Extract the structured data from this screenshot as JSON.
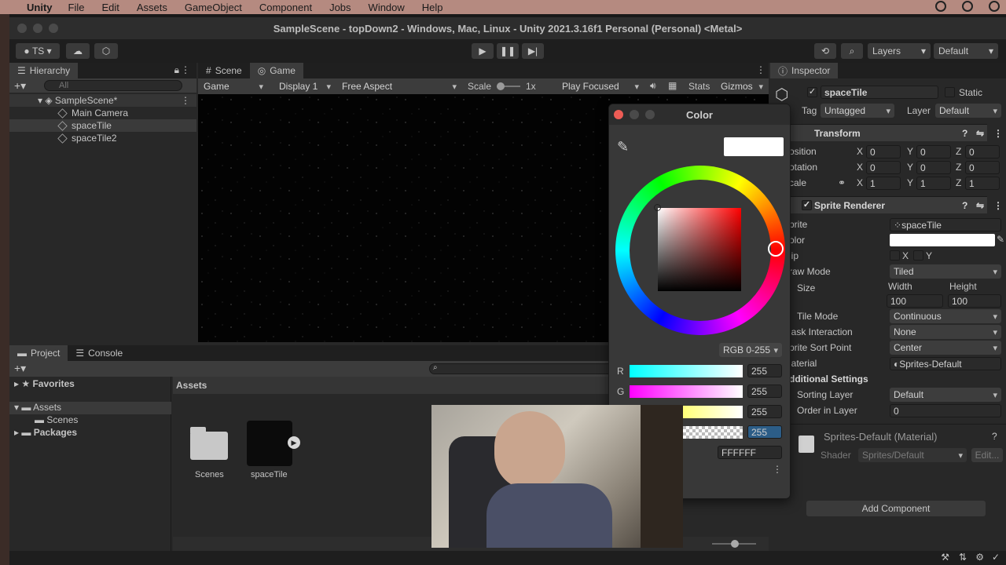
{
  "mac_menu": {
    "app": "Unity",
    "items": [
      "File",
      "Edit",
      "Assets",
      "GameObject",
      "Component",
      "Jobs",
      "Window",
      "Help"
    ]
  },
  "window_title": "SampleScene - topDown2 - Windows, Mac, Linux - Unity 2021.3.16f1 Personal (Personal) <Metal>",
  "toolbar": {
    "account": "TS",
    "layers": "Layers",
    "layout": "Default"
  },
  "hierarchy": {
    "tab": "Hierarchy",
    "search_placeholder": "All",
    "scene": "SampleScene*",
    "items": [
      "Main Camera",
      "spaceTile",
      "spaceTile2"
    ]
  },
  "scene_tabs": {
    "scene": "Scene",
    "game": "Game"
  },
  "game_bar": {
    "view": "Game",
    "display": "Display 1",
    "aspect": "Free Aspect",
    "scale_label": "Scale",
    "scale_value": "1x",
    "play_mode": "Play Focused",
    "stats": "Stats",
    "gizmos": "Gizmos"
  },
  "project": {
    "tab_project": "Project",
    "tab_console": "Console",
    "favorites": "Favorites",
    "assets": "Assets",
    "scenes": "Scenes",
    "packages": "Packages",
    "header": "Assets",
    "files": [
      "Scenes",
      "spaceTile"
    ]
  },
  "color_picker": {
    "title": "Color",
    "mode": "RGB 0-255",
    "channels": [
      {
        "label": "R",
        "value": "255"
      },
      {
        "label": "G",
        "value": "255"
      },
      {
        "label": "B",
        "value": "255"
      },
      {
        "label": "A",
        "value": "255"
      }
    ],
    "hex": "FFFFFF",
    "swatch": "#ffffff"
  },
  "inspector": {
    "tab": "Inspector",
    "object_name": "spaceTile",
    "static": "Static",
    "tag_label": "Tag",
    "tag": "Untagged",
    "layer_label": "Layer",
    "layer": "Default",
    "transform": {
      "title": "Transform",
      "position_label": "osition",
      "rotation_label": "otation",
      "scale_label": "cale",
      "position": [
        "0",
        "0",
        "0"
      ],
      "rotation": [
        "0",
        "0",
        "0"
      ],
      "scale": [
        "1",
        "1",
        "1"
      ]
    },
    "sprite_renderer": {
      "title": "Sprite Renderer",
      "sprite_label": "prite",
      "sprite": "spaceTile",
      "color_label": "olor",
      "flip_label": "lip",
      "flip_x": "X",
      "flip_y": "Y",
      "draw_mode_label": "raw Mode",
      "draw_mode": "Tiled",
      "size_label": "Size",
      "width_label": "Width",
      "height_label": "Height",
      "width": "100",
      "height": "100",
      "tile_mode_label": "Tile Mode",
      "tile_mode": "Continuous",
      "mask_label": "lask Interaction",
      "mask": "None",
      "sort_point_label": "prite Sort Point",
      "sort_point": "Center",
      "material_label": "laterial",
      "material": "Sprites-Default",
      "additional": "dditional Settings",
      "sorting_layer_label": "Sorting Layer",
      "sorting_layer": "Default",
      "order_label": "Order in Layer",
      "order": "0"
    },
    "material": {
      "title": "Sprites-Default (Material)",
      "shader_label": "Shader",
      "shader": "Sprites/Default",
      "edit": "Edit..."
    },
    "add_component": "Add Component"
  },
  "colors": {
    "accent_select": "#2c5d87",
    "window_bg": "#282828"
  }
}
